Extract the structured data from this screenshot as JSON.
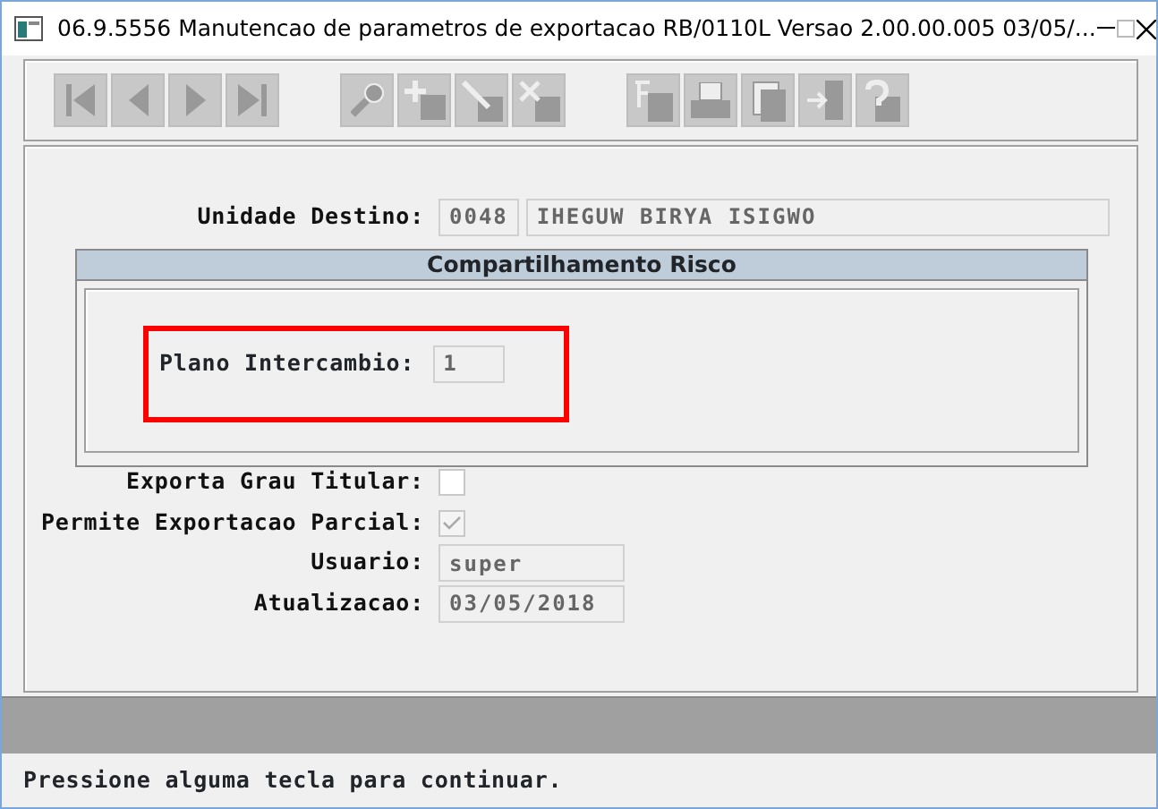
{
  "window": {
    "title": "06.9.5556 Manutencao  de parametros de exportacao RB/0110L Versao 2.00.00.005 03/05/..."
  },
  "toolbar": {
    "groups": [
      {
        "buttons": [
          {
            "kind": "first"
          },
          {
            "kind": "prev"
          },
          {
            "kind": "next"
          },
          {
            "kind": "last"
          }
        ]
      },
      {
        "buttons": [
          {
            "kind": "search"
          },
          {
            "kind": "add"
          },
          {
            "kind": "edit"
          },
          {
            "kind": "delete"
          }
        ]
      },
      {
        "buttons": [
          {
            "kind": "filter"
          },
          {
            "kind": "print"
          },
          {
            "kind": "copy"
          },
          {
            "kind": "exit"
          },
          {
            "kind": "help"
          }
        ]
      }
    ]
  },
  "form": {
    "fields": [
      {
        "kind": "code_text",
        "label": "Unidade Destino:",
        "code": "0048",
        "value": "IHEGUW BIRYA ISIGWO"
      },
      {
        "kind": "checkbox",
        "label": "Exporta Grau Titular:",
        "checked": false
      },
      {
        "kind": "checkbox",
        "label": "Permite Exportacao Parcial:",
        "checked": true
      },
      {
        "kind": "text",
        "label": "Usuario:",
        "value": "super"
      },
      {
        "kind": "text",
        "label": "Atualizacao:",
        "value": "03/05/2018"
      }
    ]
  },
  "dialog": {
    "title": "Compartilhamento Risco",
    "field": {
      "label": "Plano Intercambio:",
      "value": "1",
      "highlighted": true
    }
  },
  "status_bar": {
    "message": "Pressione alguma tecla para continuar."
  }
}
